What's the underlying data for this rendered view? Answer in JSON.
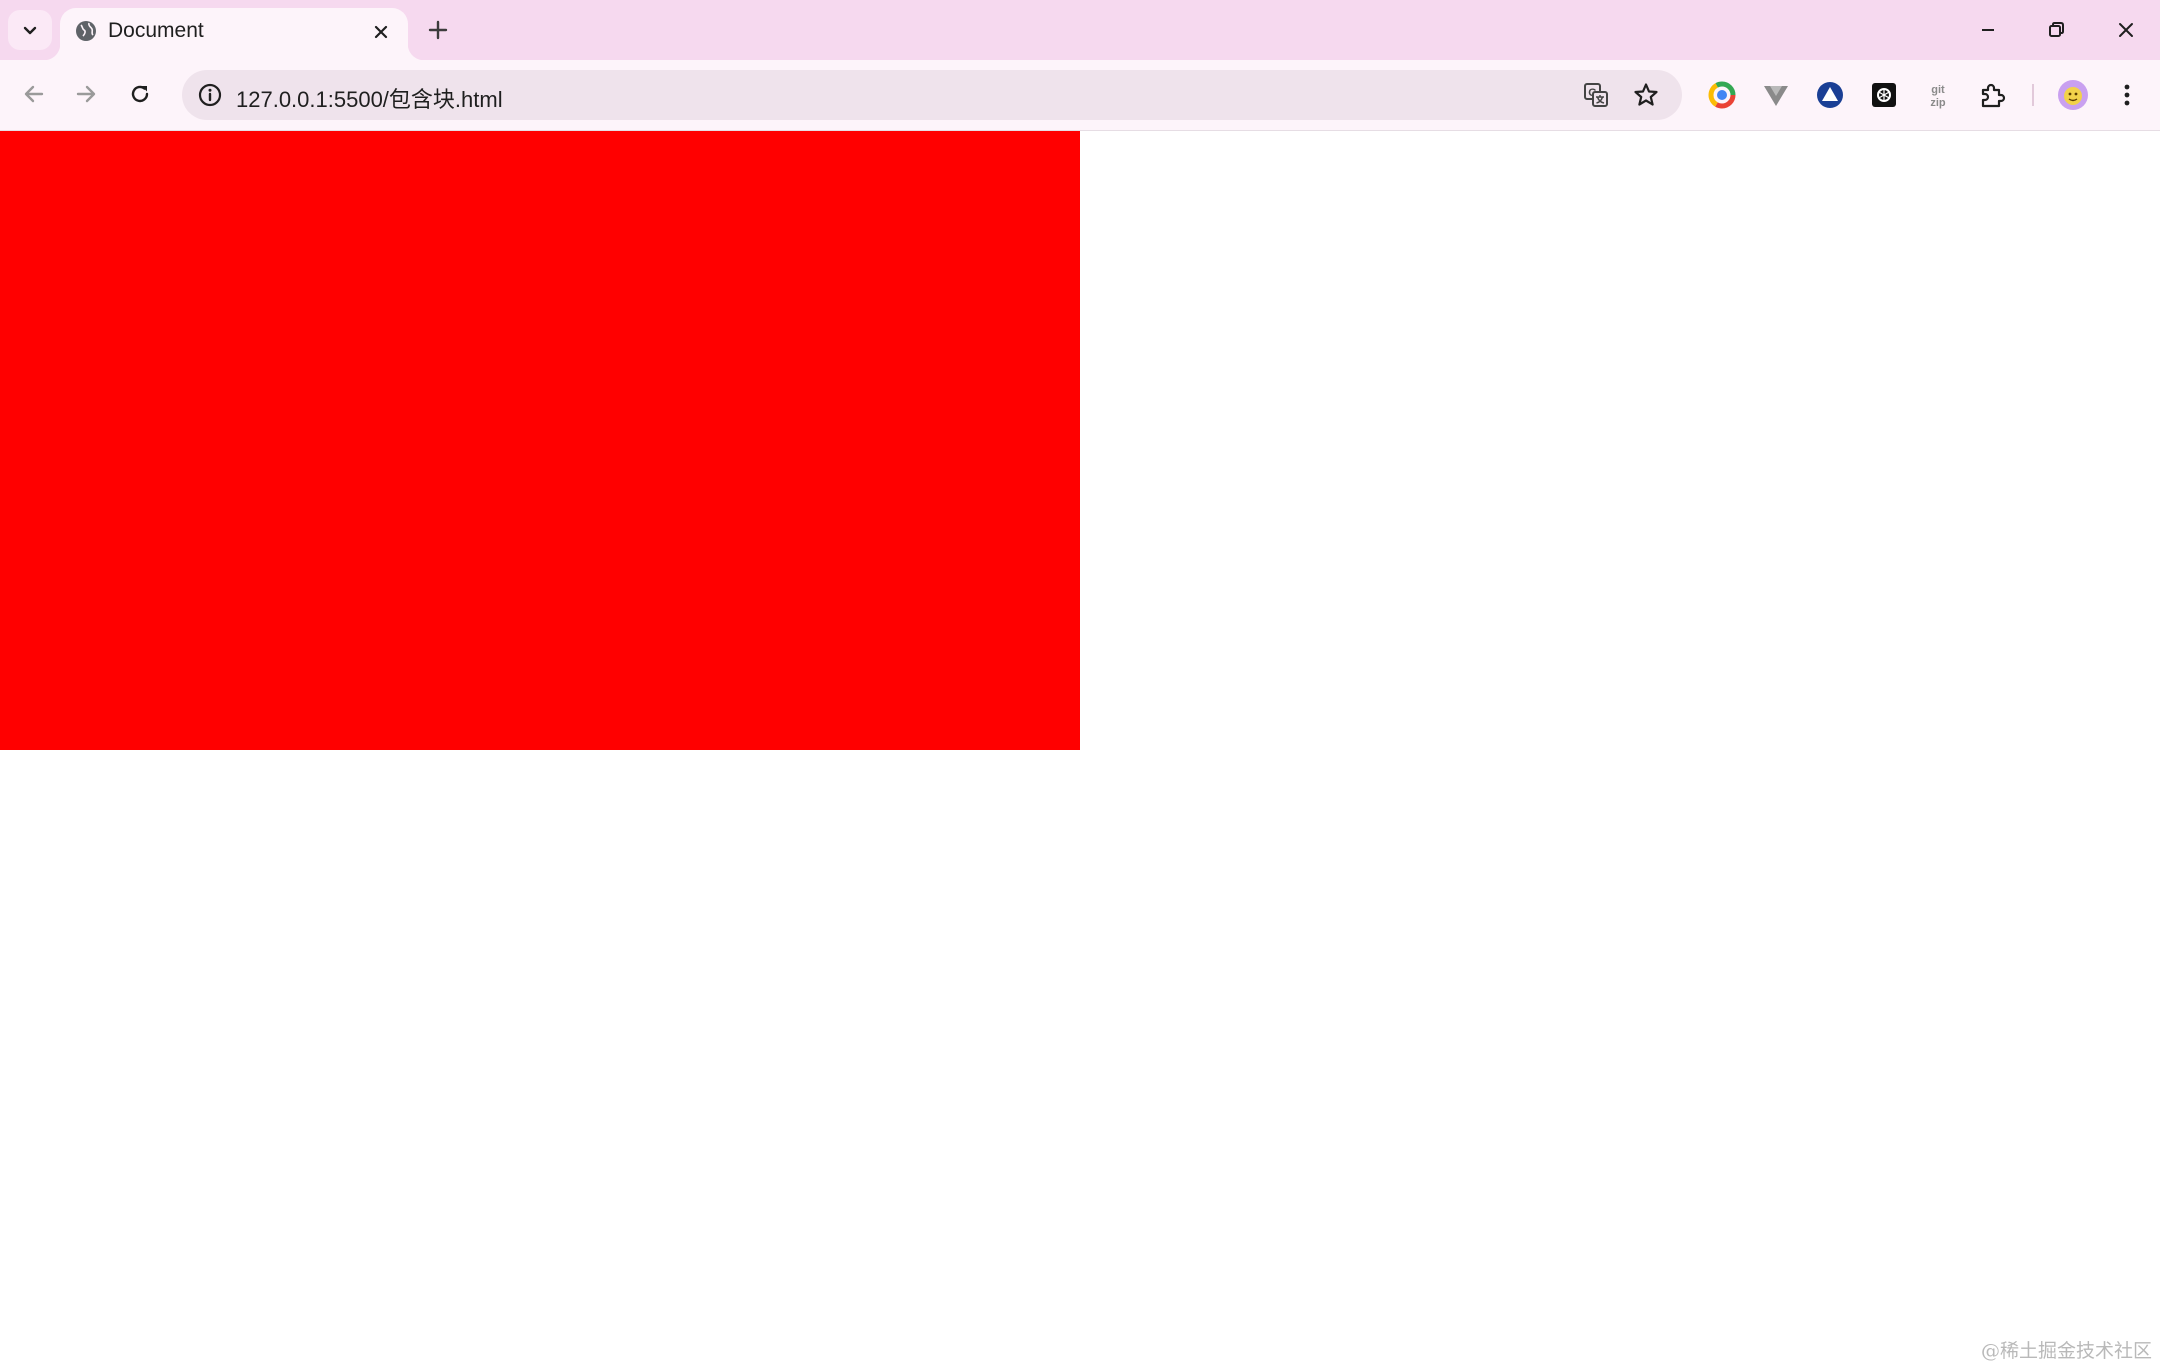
{
  "tab": {
    "title": "Document"
  },
  "address_bar": {
    "url": "127.0.0.1:5500/包含块.html"
  },
  "page": {
    "block_color": "#ff0000"
  },
  "watermark": "@稀土掘金技术社区",
  "icons": {
    "tab_search": "chevron-down-icon",
    "favicon": "globe-icon",
    "tab_close": "close-icon",
    "new_tab": "plus-icon",
    "minimize": "minimize-icon",
    "restore": "restore-icon",
    "close_window": "close-icon",
    "back": "arrow-left-icon",
    "forward": "arrow-right-icon",
    "reload": "reload-icon",
    "site_info": "info-icon",
    "translate": "translate-icon",
    "bookmark": "star-icon",
    "extensions": [
      "color-ring-icon",
      "v-icon",
      "triangle-icon",
      "chatgpt-icon",
      "gitzip-icon",
      "puzzle-icon"
    ],
    "profile": "avatar",
    "menu": "kebab-menu-icon"
  }
}
